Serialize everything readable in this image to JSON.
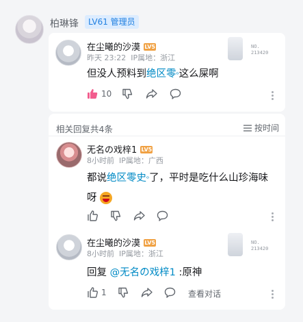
{
  "header": {
    "user_name": "柏琳锋",
    "badge": "LV61 管理员"
  },
  "main_comment": {
    "user_name": "在尘曦的沙漠",
    "level": "LV5",
    "time": "昨天 23:22",
    "ip": "IP属地：浙江",
    "card_number": "NO.\n213420",
    "content_before": "但没人预料到",
    "content_link": "绝区零",
    "content_after": "这么屎啊",
    "like_count": "10",
    "icon_like": "thumbs-up-filled-icon",
    "icon_dislike": "thumbs-down-icon",
    "icon_share": "share-icon",
    "icon_reply": "comment-bubble-icon"
  },
  "replies_section": {
    "header_text": "相关回复共4条",
    "sort_label": "按时间"
  },
  "reply1": {
    "user_name": "无名の戏梓1",
    "level": "LV5",
    "time": "8小时前",
    "ip": "IP属地：广西",
    "content_before": "都说",
    "content_link": "绝区零史",
    "content_after_line1": "了，平时是吃什么山珍海味",
    "content_line2": "呀"
  },
  "reply2": {
    "user_name": "在尘曦的沙漠",
    "level": "LV5",
    "time": "8小时前",
    "ip": "IP属地：浙江",
    "card_number": "NO.\n213420",
    "reply_prefix": "回复",
    "mention": "@无名の戏梓1",
    "content_after": ":原神",
    "like_count": "1",
    "view_dialog": "查看对话"
  },
  "colors": {
    "accent_blue": "#008ac5",
    "like_pink": "#f25d8e",
    "badge_bg": "#dcecff",
    "badge_text": "#1f7fe0",
    "level_orange": "#f0a143"
  }
}
